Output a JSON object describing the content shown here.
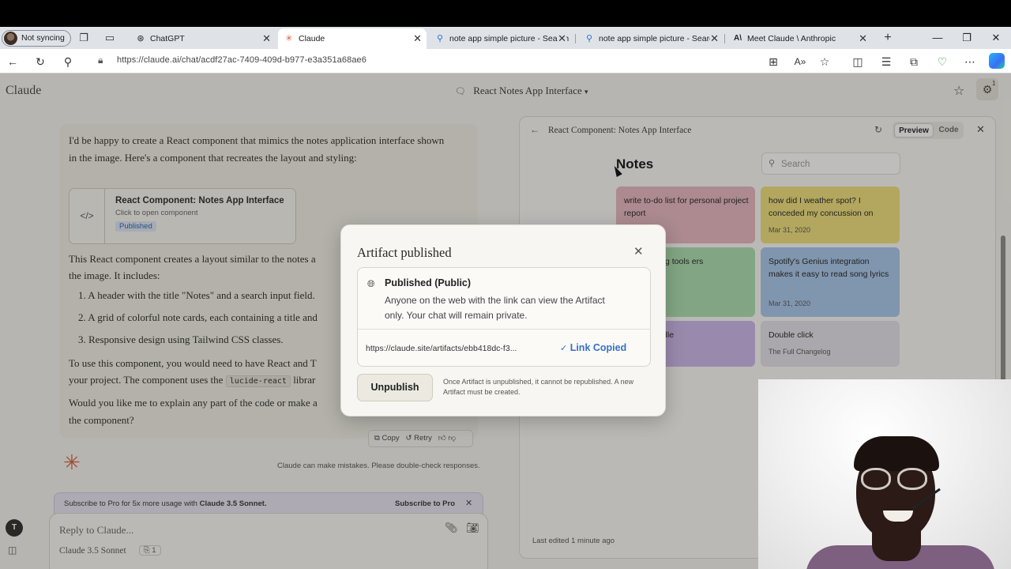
{
  "browser": {
    "profile": "Not syncing",
    "tabs": [
      {
        "title": "ChatGPT",
        "icon": "chatgpt-icon"
      },
      {
        "title": "Claude",
        "icon": "claude-icon",
        "active": true
      },
      {
        "title": "note app simple picture - Search",
        "icon": "search-icon"
      },
      {
        "title": "note app simple picture - Search",
        "icon": "search-icon"
      },
      {
        "title": "Meet Claude \\ Anthropic",
        "icon": "anthropic-icon"
      }
    ],
    "url": "https://claude.ai/chat/acdf27ac-7409-409d-b977-e3a351a68ae6"
  },
  "app": {
    "brand": "Claude",
    "chat_title": "React Notes App Interface",
    "settings_badge": "1"
  },
  "message": {
    "intro": "I'd be happy to create a React component that mimics the notes application interface shown in the image. Here's a component that recreates the layout and styling:",
    "artifact_title": "React Component: Notes App Interface",
    "artifact_sub": "Click to open component",
    "artifact_status": "Published",
    "desc": "This React component creates a layout similar to the notes a",
    "desc2": "the image. It includes:",
    "items": [
      "1. A header with the title \"Notes\" and a search input field.",
      "2. A grid of colorful note cards, each containing a title and",
      "3. Responsive design using Tailwind CSS classes."
    ],
    "usage1": "To use this component, you would need to have React and T",
    "usage2a": "your project. The component uses the",
    "usage_code": "lucide-react",
    "usage2b": "librar",
    "ask1": "Would you like me to explain any part of the code or make a",
    "ask2": "the component?",
    "copy_label": "Copy",
    "retry_label": "Retry"
  },
  "disclaimer": "Claude can make mistakes. Please double-check responses.",
  "subscribe": {
    "text_prefix": "Subscribe to Pro for 5x more usage with",
    "text_bold": "Claude 3.5 Sonnet.",
    "cta": "Subscribe to Pro"
  },
  "composer": {
    "placeholder": "Reply to Claude...",
    "model": "Claude 3.5 Sonnet",
    "badge": "1",
    "user_initial": "T"
  },
  "panel": {
    "title": "React Component: Notes App Interface",
    "preview_label": "Preview",
    "code_label": "Code",
    "notes_heading": "Notes",
    "search_placeholder": "Search",
    "notes": [
      {
        "title": "write to-do list for personal project report",
        "date": "",
        "color": "#e5b7bf"
      },
      {
        "title": "how did I weather spot? I conceded my concussion on",
        "date": "Mar 31, 2020",
        "color": "#efe07a"
      },
      {
        "title": "t font pairing tools ers",
        "date": "",
        "color": "#a9dfae"
      },
      {
        "title": "Spotify's Genius integration makes it easy to read song lyrics",
        "date": "Mar 31, 2020",
        "color": "#a6c7ec"
      },
      {
        "title": "enters middle",
        "date": "",
        "color": "#cbb7ea"
      },
      {
        "title": "Double click",
        "date": "The Full Changelog",
        "color": "#e3e1e8"
      }
    ],
    "last_edited": "Last edited 1 minute ago"
  },
  "modal": {
    "title": "Artifact published",
    "pub_heading": "Published (Public)",
    "pub_desc": "Anyone on the web with the link can view the Artifact only. Your chat will remain private.",
    "link": "https://claude.site/artifacts/ebb418dc-f3...",
    "copied_label": "Link Copied",
    "unpublish_label": "Unpublish",
    "unpublish_note": "Once Artifact is unpublished, it cannot be republished. A new Artifact must be created."
  }
}
